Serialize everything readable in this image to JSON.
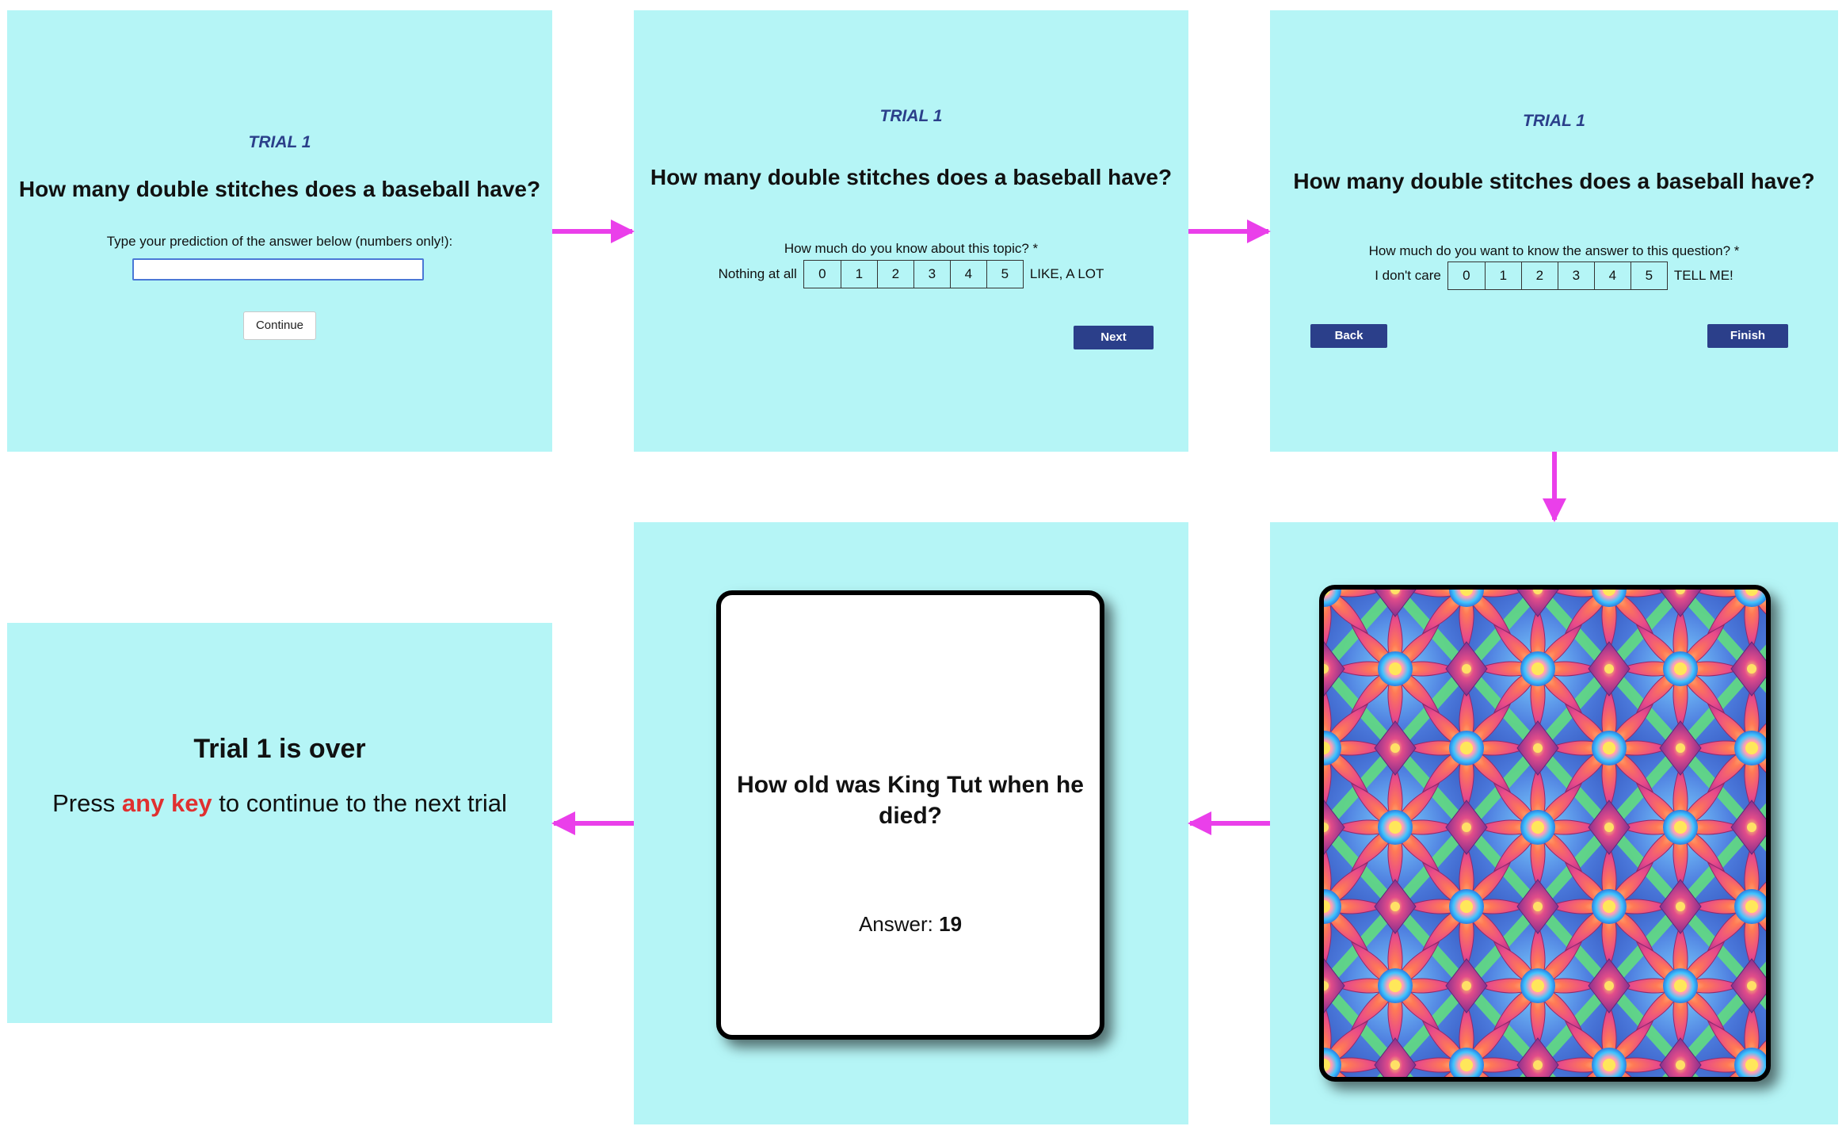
{
  "colors": {
    "panel_bg": "#b5f5f6",
    "arrow": "#ea3fea",
    "trial_label": "#2b3f8a",
    "button": "#2b3f8a",
    "highlight": "#e03030"
  },
  "screen1": {
    "trial_label": "TRIAL 1",
    "question": "How many double stitches does a baseball have?",
    "instruction": "Type your prediction of the answer below (numbers only!):",
    "input_value": "",
    "continue_label": "Continue"
  },
  "screen2": {
    "trial_label": "TRIAL 1",
    "question": "How many double stitches does a baseball have?",
    "prompt": "How much do you know about this topic?  *",
    "left_anchor": "Nothing at all",
    "right_anchor": "LIKE, A LOT",
    "scale": [
      "0",
      "1",
      "2",
      "3",
      "4",
      "5"
    ],
    "next_label": "Next"
  },
  "screen3": {
    "trial_label": "TRIAL 1",
    "question": "How many double stitches does a baseball have?",
    "prompt": "How much do you want to know the answer to this question?  *",
    "left_anchor": "I don't care",
    "right_anchor": "TELL ME!",
    "scale": [
      "0",
      "1",
      "2",
      "3",
      "4",
      "5"
    ],
    "back_label": "Back",
    "finish_label": "Finish"
  },
  "screen4": {
    "image": "kaleidoscope-flower-pattern"
  },
  "screen5": {
    "question": "How old was King Tut when he died?",
    "answer_label": "Answer: ",
    "answer_value": "19"
  },
  "screen6": {
    "title": "Trial 1 is over",
    "msg_prefix": "Press ",
    "msg_key": "any key",
    "msg_suffix": " to continue to the next trial"
  }
}
